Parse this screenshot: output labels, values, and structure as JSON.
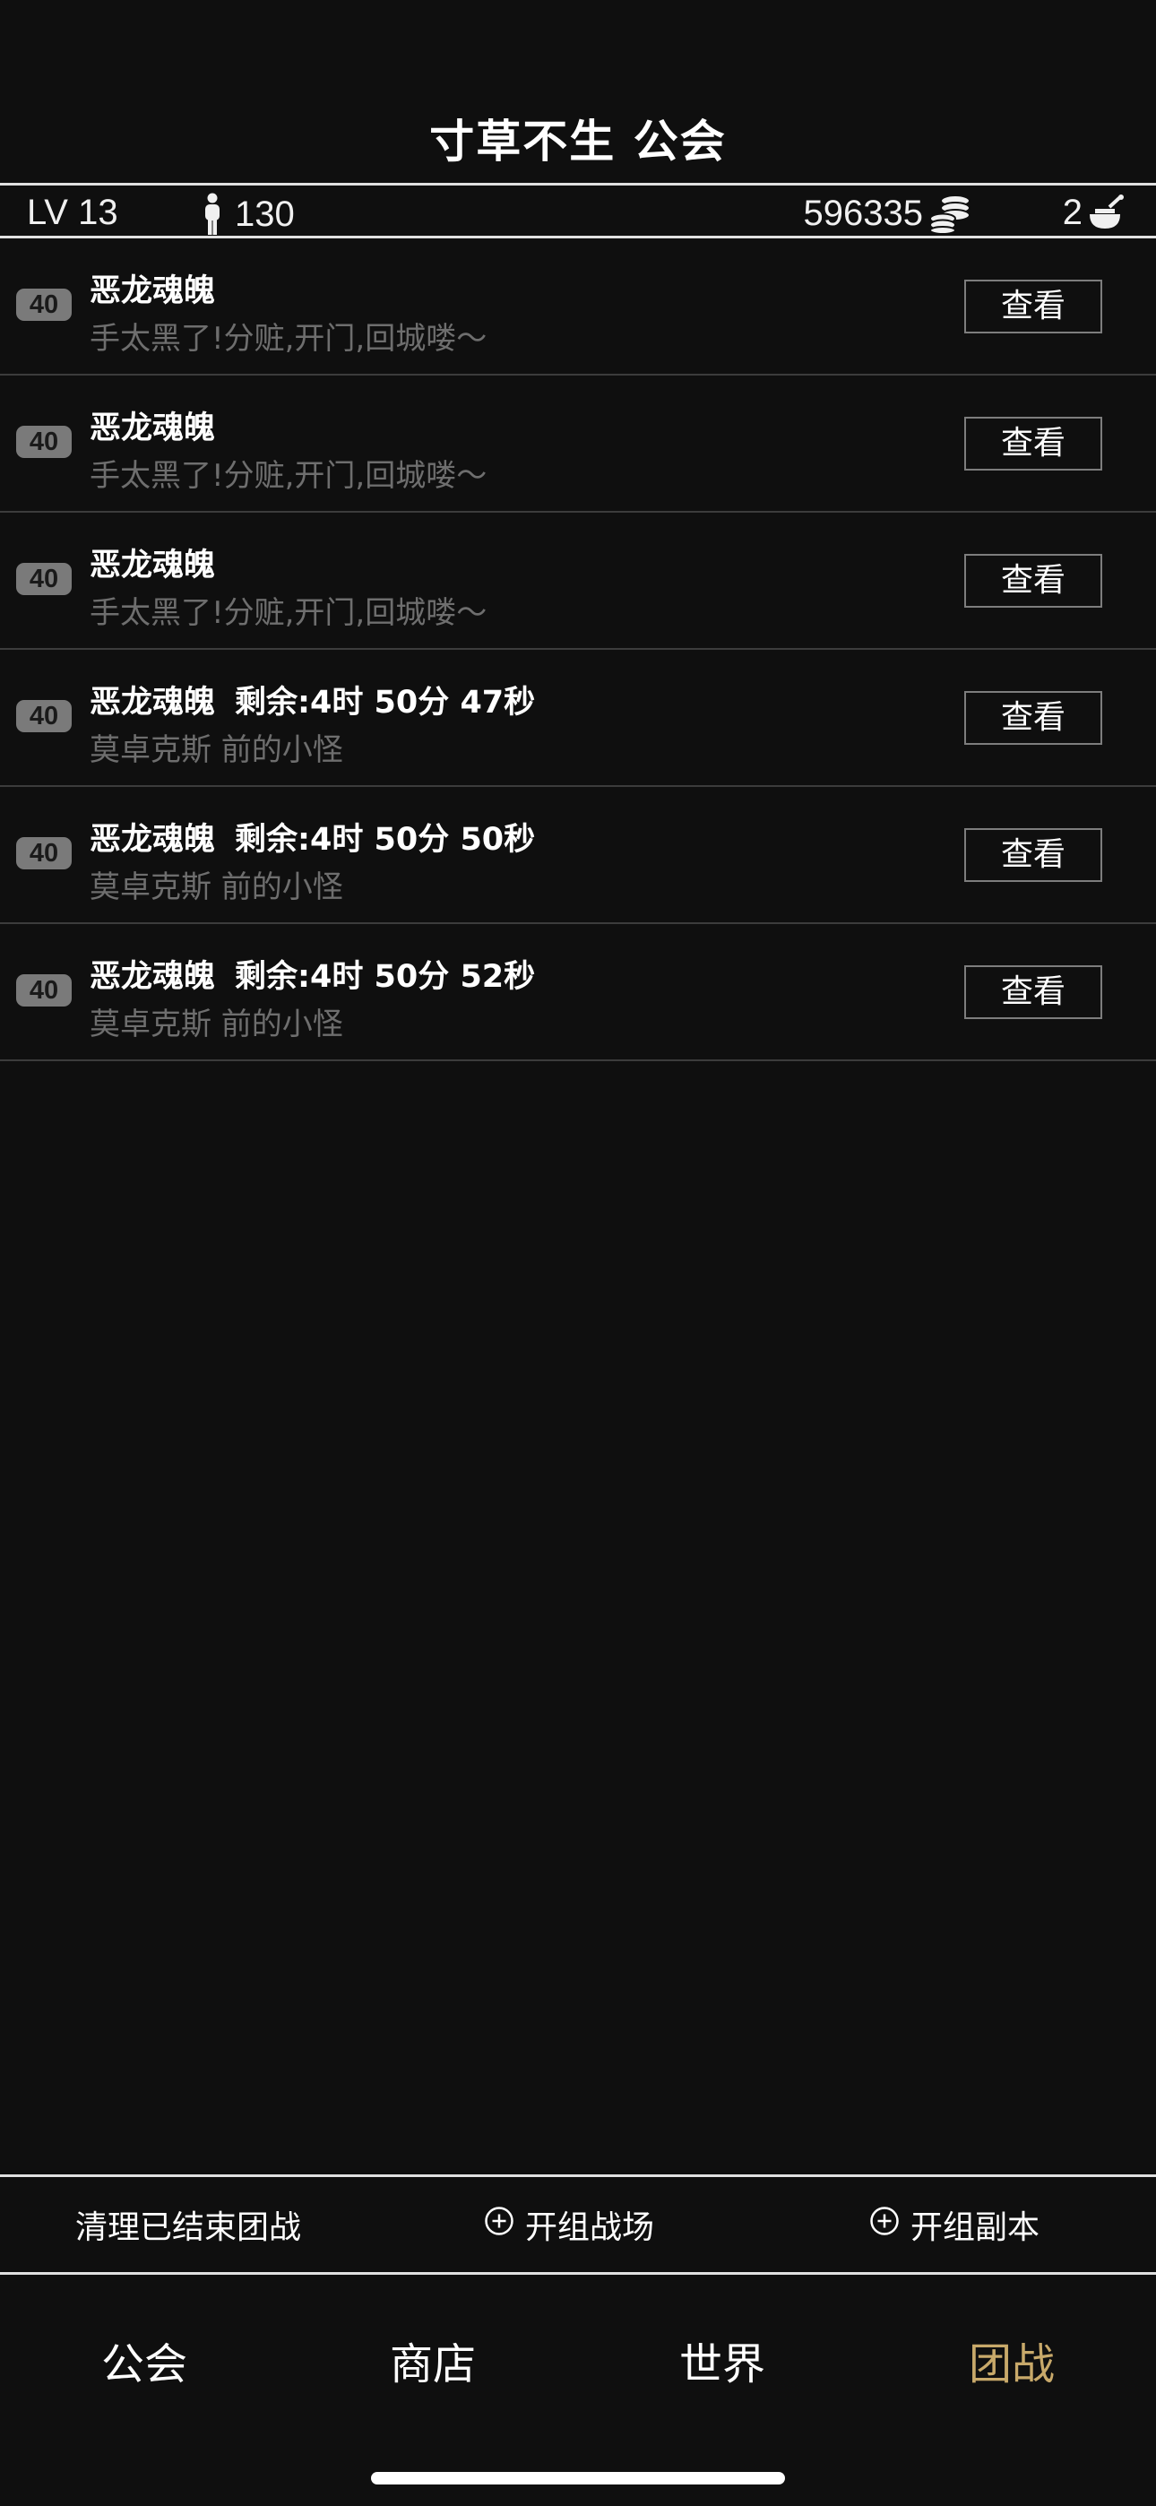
{
  "header": {
    "title": "寸草不生 公会"
  },
  "status": {
    "level": "LV 13",
    "members": "130",
    "gold": "596335",
    "tickets": "2",
    "member_icon": "person-icon",
    "gold_icon": "coin-stack-icon",
    "ticket_icon": "ticket-icon"
  },
  "raids": [
    {
      "level": "40",
      "title": "恶龙魂魄",
      "timer": "",
      "subtitle": "手太黑了!分赃,开门,回城喽～",
      "button": "查看"
    },
    {
      "level": "40",
      "title": "恶龙魂魄",
      "timer": "",
      "subtitle": "手太黑了!分赃,开门,回城喽～",
      "button": "查看"
    },
    {
      "level": "40",
      "title": "恶龙魂魄",
      "timer": "",
      "subtitle": "手太黑了!分赃,开门,回城喽～",
      "button": "查看"
    },
    {
      "level": "40",
      "title": "恶龙魂魄",
      "timer": "剩余:4时 50分 47秒",
      "subtitle": "莫卓克斯 前的小怪",
      "button": "查看"
    },
    {
      "level": "40",
      "title": "恶龙魂魄",
      "timer": "剩余:4时 50分 50秒",
      "subtitle": "莫卓克斯 前的小怪",
      "button": "查看"
    },
    {
      "level": "40",
      "title": "恶龙魂魄",
      "timer": "剩余:4时 50分 52秒",
      "subtitle": "莫卓克斯 前的小怪",
      "button": "查看"
    }
  ],
  "actions": {
    "clear": "清理已结束团战",
    "open_battlefield": "开组战场",
    "open_dungeon": "开组副本",
    "plus_icon": "plus-circle-icon"
  },
  "tabs": [
    {
      "label": "公会",
      "active": false
    },
    {
      "label": "商店",
      "active": false
    },
    {
      "label": "世界",
      "active": false
    },
    {
      "label": "团战",
      "active": true
    }
  ],
  "colors": {
    "background": "#0f0f0f",
    "active_tab": "#c8a96a",
    "subtitle": "#6e6e6e",
    "badge": "#7a7a7a"
  }
}
